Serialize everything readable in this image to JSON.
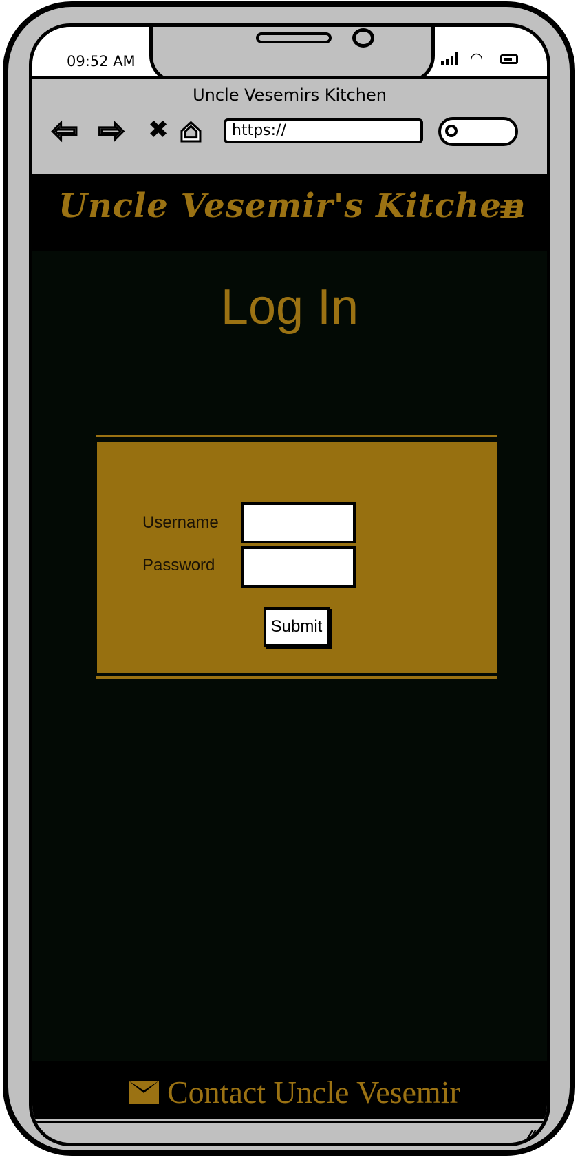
{
  "status_bar": {
    "time": "09:52 AM"
  },
  "browser": {
    "title": "Uncle Vesemirs Kitchen",
    "url": "https://",
    "back_icon": "⇦",
    "forward_icon": "⇨",
    "stop_icon": "✖",
    "home_icon": "⌂"
  },
  "site": {
    "brand": "Uncle Vesemir's Kitchen",
    "menu_icon": "≡"
  },
  "login": {
    "title": "Log In",
    "username_label": "Username",
    "password_label": "Password",
    "username_value": "",
    "password_value": "",
    "submit_label": "Submit"
  },
  "footer": {
    "contact_label": "Contact Uncle Vesemir"
  },
  "colors": {
    "accent": "#9b7213",
    "page_bg": "#030a05",
    "card": "#977010"
  }
}
